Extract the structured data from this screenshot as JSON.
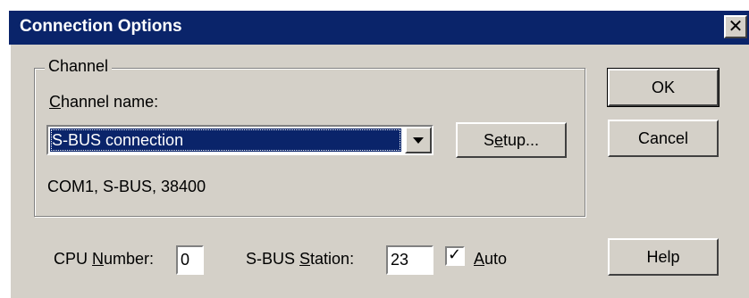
{
  "window": {
    "title": "Connection Options",
    "close_glyph": "✕"
  },
  "channel_group": {
    "legend": "Channel",
    "name_label_accel": "C",
    "name_label_rest": "hannel name:",
    "selected_channel": "S-BUS connection",
    "setup_button_pre": "S",
    "setup_button_accel": "e",
    "setup_button_post": "tup...",
    "info_text": "COM1, S-BUS, 38400"
  },
  "buttons": {
    "ok": "OK",
    "cancel": "Cancel",
    "help": "Help"
  },
  "cpu": {
    "label_pre": "CPU ",
    "label_accel": "N",
    "label_post": "umber:",
    "value": "0"
  },
  "station": {
    "label_pre": "S-BUS ",
    "label_accel": "S",
    "label_post": "tation:",
    "value": "23"
  },
  "auto": {
    "label_accel": "A",
    "label_rest": "uto",
    "checked": true,
    "check_glyph": "✓"
  },
  "colors": {
    "title_bar": "#0a246a",
    "face": "#d4d0c8",
    "selection": "#0a246a"
  }
}
